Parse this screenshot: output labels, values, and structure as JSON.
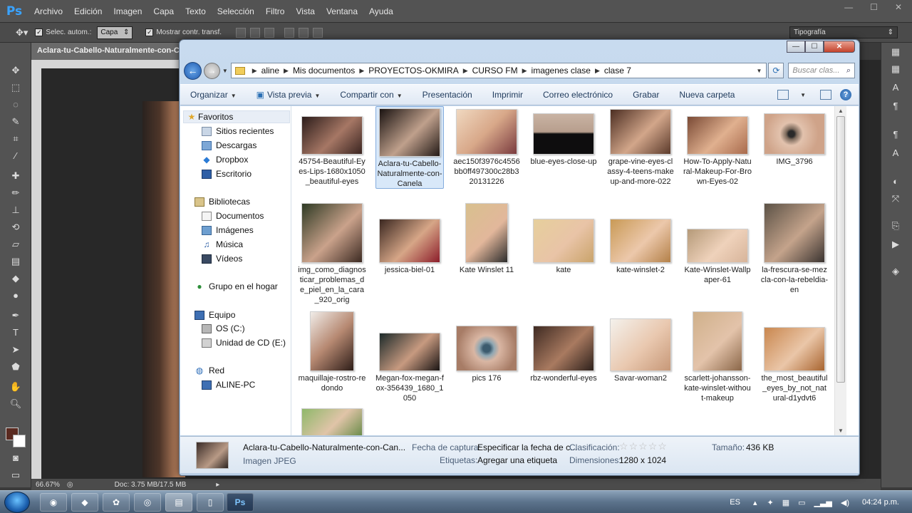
{
  "photoshop": {
    "logo": "Ps",
    "menus": [
      "Archivo",
      "Edición",
      "Imagen",
      "Capa",
      "Texto",
      "Selección",
      "Filtro",
      "Vista",
      "Ventana",
      "Ayuda"
    ],
    "options": {
      "auto_select_label": "Selec. autom.:",
      "auto_select_value": "Capa",
      "show_transform_label": "Mostrar contr. transf."
    },
    "workspace": "Tipografía",
    "document_tab": "Aclara-tu-Cabello-Naturalmente-con-Can...",
    "zoom": "66.67%",
    "doc_size": "Doc: 3.75 MB/17.5 MB"
  },
  "explorer": {
    "breadcrumb": [
      "aline",
      "Mis documentos",
      "PROYECTOS-OKMIRA",
      "CURSO FM",
      "imagenes clase",
      "clase 7"
    ],
    "search_placeholder": "Buscar clas...",
    "toolbar": {
      "organize": "Organizar",
      "preview": "Vista previa",
      "share": "Compartir con",
      "slideshow": "Presentación",
      "print": "Imprimir",
      "email": "Correo electrónico",
      "burn": "Grabar",
      "new_folder": "Nueva carpeta"
    },
    "nav": {
      "favorites": "Favoritos",
      "recent": "Sitios recientes",
      "downloads": "Descargas",
      "dropbox": "Dropbox",
      "desktop": "Escritorio",
      "libraries": "Bibliotecas",
      "documents": "Documentos",
      "images": "Imágenes",
      "music": "Música",
      "videos": "Vídeos",
      "homegroup": "Grupo en el hogar",
      "computer": "Equipo",
      "drive_c": "OS (C:)",
      "drive_e": "Unidad de CD (E:)",
      "network": "Red",
      "pc": "ALINE-PC"
    },
    "files": [
      "45754-Beautiful-Eyes-Lips-1680x1050_beautiful-eyes",
      "Aclara-tu-Cabello-Naturalmente-con-Canela",
      "aec150f3976c4556bb0ff497300c28b320131226",
      "blue-eyes-close-up",
      "grape-vine-eyes-classy-4-teens-makeup-and-more-022",
      "How-To-Apply-Natural-Makeup-For-Brown-Eyes-02",
      "IMG_3796",
      "img_como_diagnosticar_problemas_de_piel_en_la_cara_920_orig",
      "jessica-biel-01",
      "Kate Winslet 11",
      "kate",
      "kate-winslet-2",
      "Kate-Winslet-Wallpaper-61",
      "la-frescura-se-mezcla-con-la-rebeldia-en",
      "maquillaje-rostro-redondo",
      "Megan-fox-megan-fox-356439_1680_1050",
      "pics 176",
      "rbz-wonderful-eyes",
      "Savar-woman2",
      "scarlett-johansson-kate-winslet-without-makeup",
      "the_most_beautiful_eyes_by_not_natural-d1ydvt6"
    ],
    "details": {
      "filename": "Aclara-tu-Cabello-Naturalmente-con-Can...",
      "filetype": "Imagen JPEG",
      "capture_date_label": "Fecha de captura:",
      "capture_date_value": "Especificar la fecha de c...",
      "rating_label": "Clasificación:",
      "tags_label": "Etiquetas:",
      "tags_value": "Agregar una etiqueta",
      "dimensions_label": "Dimensiones:",
      "dimensions_value": "1280 x 1024",
      "size_label": "Tamaño:",
      "size_value": "436 KB"
    }
  },
  "taskbar": {
    "language": "ES",
    "time": "04:24 p.m."
  }
}
